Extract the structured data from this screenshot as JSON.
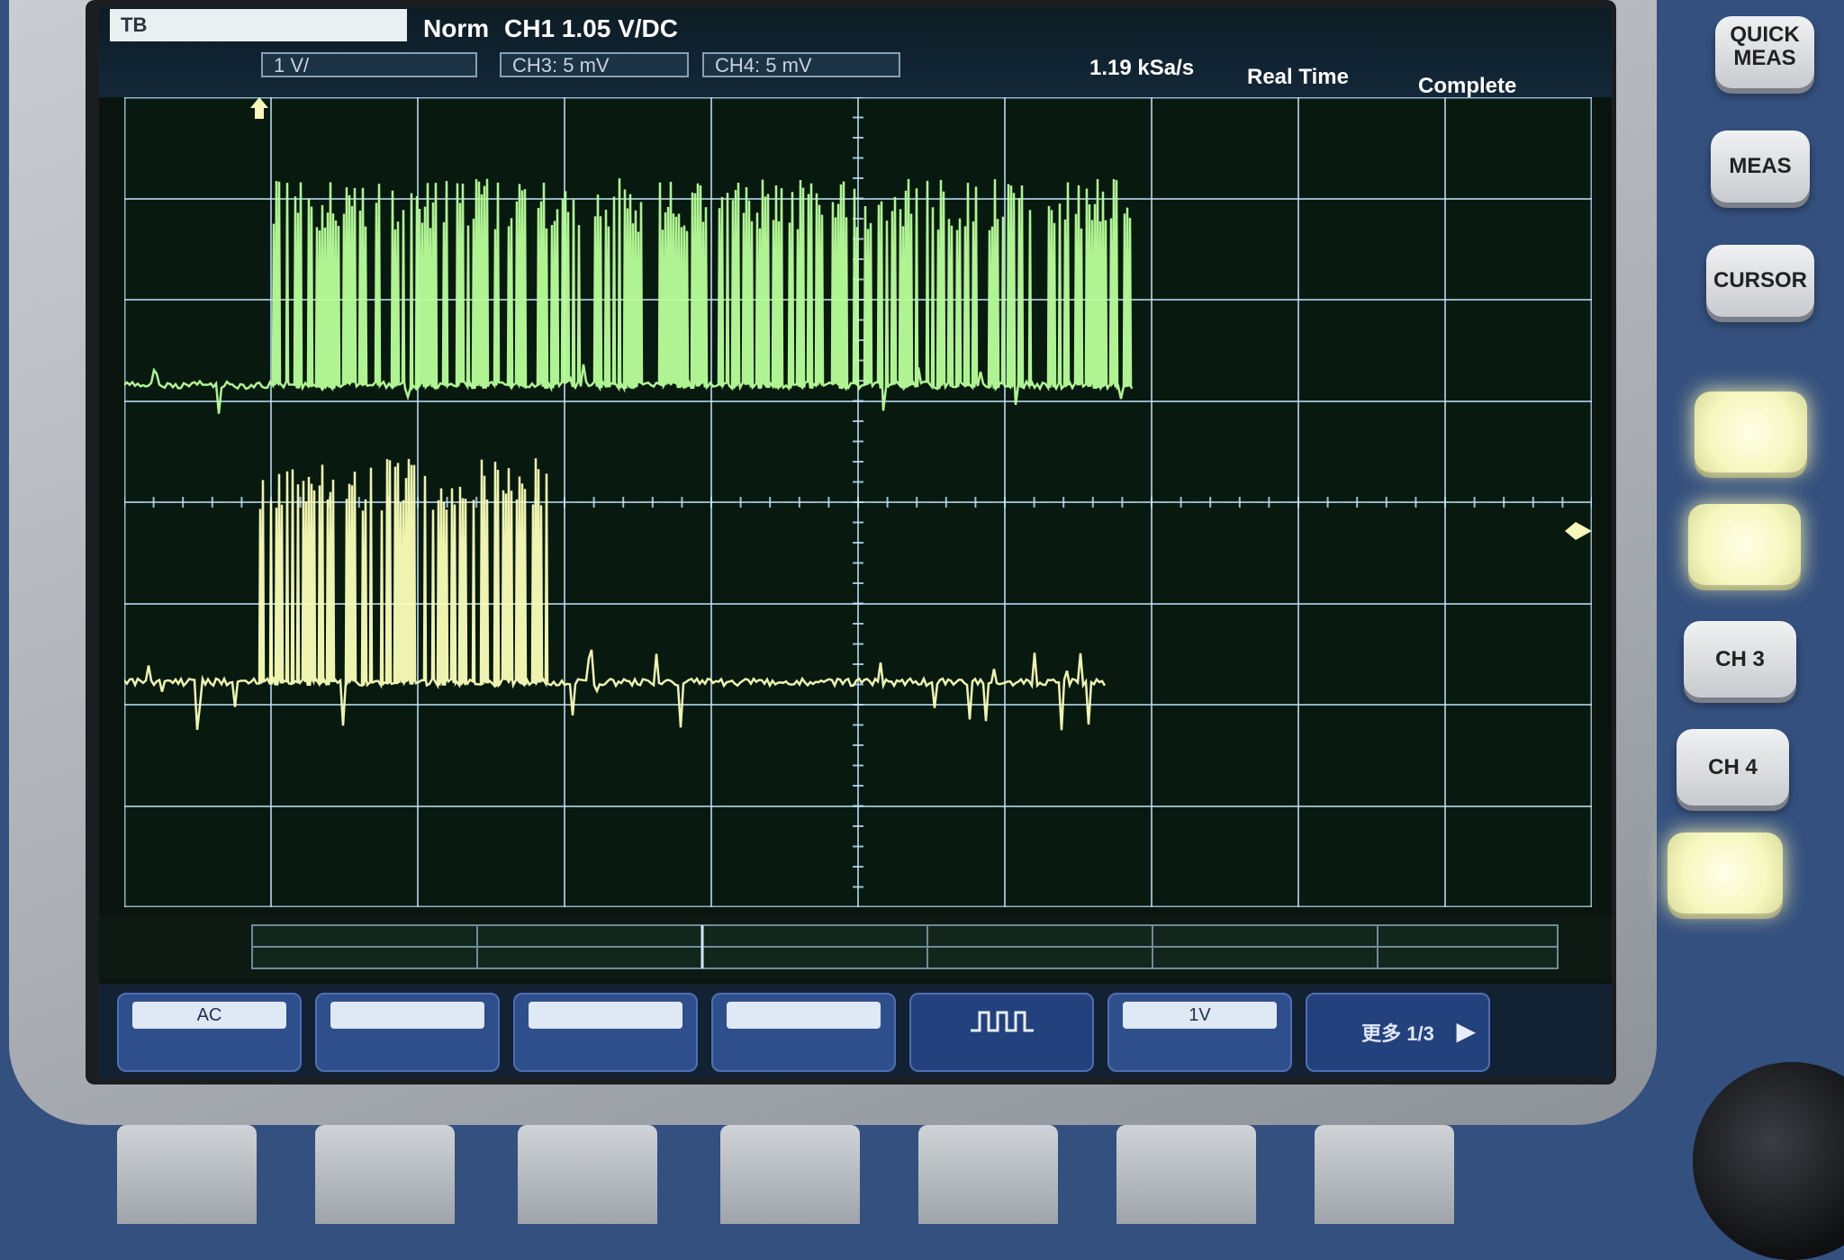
{
  "header": {
    "trigger_box": "TB",
    "trigger_mode": "Norm",
    "ch1_scale": "CH1 1.05 V/DC",
    "ch2_box": "1 V/",
    "ch3_box": "CH3: 5 mV",
    "ch4_box": "CH4: 5 mV",
    "sample_rate": "1.19 kSa/s",
    "acquisition_mode": "Real Time",
    "acquisition_status": "Complete"
  },
  "softkeys": [
    {
      "title": "",
      "value": "AC"
    },
    {
      "title": "",
      "value": ""
    },
    {
      "title": "",
      "value": ""
    },
    {
      "title": "",
      "value": ""
    },
    {
      "title": "",
      "value": ""
    },
    {
      "title": "",
      "value": "1V"
    },
    {
      "title": "更多 1/3",
      "value": ""
    }
  ],
  "hardware_buttons": {
    "quick_meas": "QUICK MEAS",
    "meas": "MEAS",
    "cursor": "CURSOR",
    "ch3": "CH 3",
    "ch4": "CH 4"
  },
  "colors": {
    "ch1_trace": "#b8ff9a",
    "ch2_trace": "#fbffb8",
    "grid": "#bfe6ff",
    "lit_button": "#f7f7c0"
  }
}
